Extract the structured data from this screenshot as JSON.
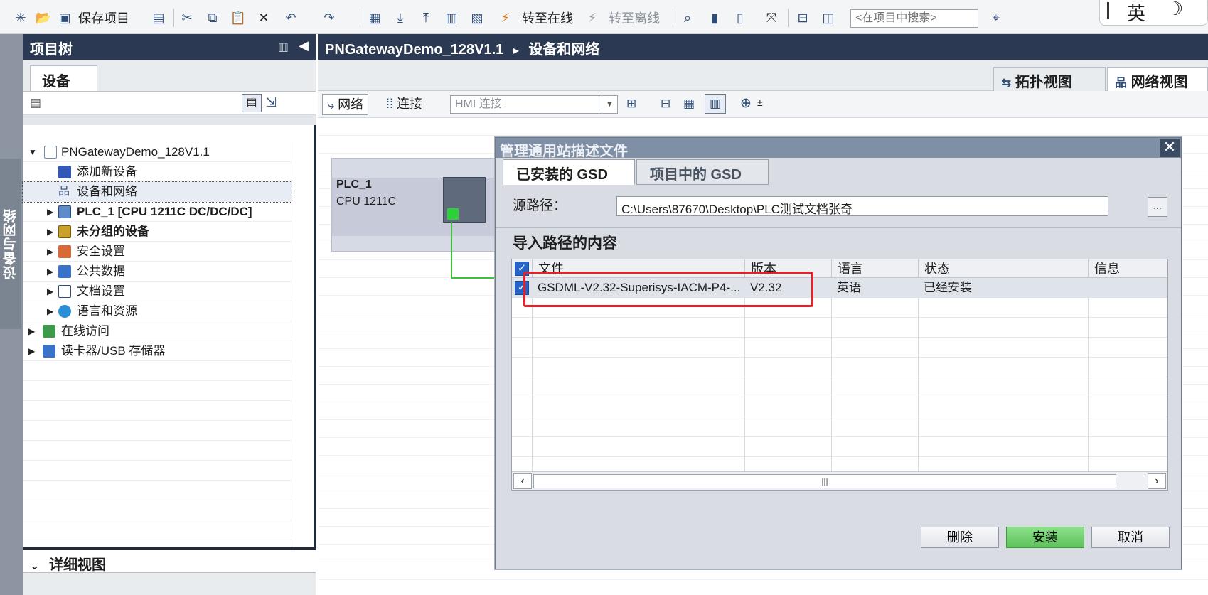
{
  "toolbar": {
    "save_project": "保存项目",
    "go_online": "转至在线",
    "go_offline": "转至离线",
    "search_placeholder": "<在项目中搜索>",
    "ime_lang": "英"
  },
  "sidebar": {
    "vertical_tab": "设备与网络"
  },
  "project_tree": {
    "title": "项目树",
    "tab": "设备",
    "items": [
      {
        "label": "PNGatewayDemo_128V1.1"
      },
      {
        "label": "添加新设备"
      },
      {
        "label": "设备和网络"
      },
      {
        "label": "PLC_1 [CPU 1211C DC/DC/DC]"
      },
      {
        "label": "未分组的设备"
      },
      {
        "label": "安全设置"
      },
      {
        "label": "公共数据"
      },
      {
        "label": "文档设置"
      },
      {
        "label": "语言和资源"
      },
      {
        "label": "在线访问"
      },
      {
        "label": "读卡器/USB 存储器"
      }
    ],
    "detail_view": "详细视图"
  },
  "editor": {
    "breadcrumb_project": "PNGatewayDemo_128V1.1",
    "breadcrumb_sep": "▸",
    "breadcrumb_page": "设备和网络",
    "tab_topology": "拓扑视图",
    "tab_network": "网络视图",
    "network_btn": "网络",
    "connections_btn": "连接",
    "connection_type": "HMI 连接",
    "plc_name": "PLC_1",
    "plc_cpu": "CPU 1211C"
  },
  "dialog": {
    "title": "管理通用站描述文件",
    "tab_installed": "已安装的 GSD",
    "tab_project": "项目中的 GSD",
    "source_label": "源路径：",
    "source_path": "C:\\Users\\87670\\Desktop\\PLC测试文档张奇",
    "browse": "...",
    "content_heading": "导入路径的内容",
    "columns": {
      "file": "文件",
      "version": "版本",
      "language": "语言",
      "status": "状态",
      "info": "信息"
    },
    "rows": [
      {
        "file": "GSDML-V2.32-Superisys-IACM-P4-...",
        "version": "V2.32",
        "language": "英语",
        "status": "已经安装",
        "info": ""
      }
    ],
    "btn_delete": "删除",
    "btn_install": "安装",
    "btn_cancel": "取消"
  },
  "colors": {
    "header_bg": "#2b3a52",
    "highlight": "#e8202a",
    "install_btn": "#5dc25a"
  }
}
